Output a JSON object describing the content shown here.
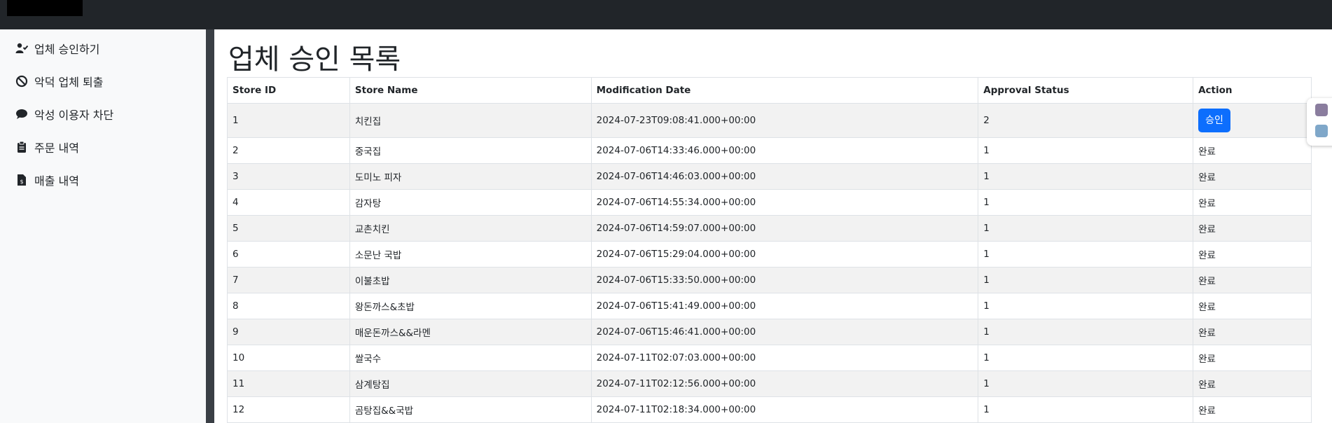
{
  "sidebar": {
    "items": [
      {
        "label": "업체 승인하기",
        "icon": "user-check-icon"
      },
      {
        "label": "악덕 업체 퇴출",
        "icon": "ban-icon"
      },
      {
        "label": "악성 이용자 차단",
        "icon": "comment-icon"
      },
      {
        "label": "주문 내역",
        "icon": "clipboard-icon"
      },
      {
        "label": "매출 내역",
        "icon": "file-invoice-dollar-icon"
      }
    ]
  },
  "main": {
    "title": "업체 승인 목록",
    "table": {
      "headers": [
        "Store ID",
        "Store Name",
        "Modification Date",
        "Approval Status",
        "Action"
      ],
      "rows": [
        {
          "id": "1",
          "name": "치킨집",
          "date": "2024-07-23T09:08:41.000+00:00",
          "status": "2",
          "action": "승인"
        },
        {
          "id": "2",
          "name": "중국집",
          "date": "2024-07-06T14:33:46.000+00:00",
          "status": "1",
          "action": "완료"
        },
        {
          "id": "3",
          "name": "도미노 피자",
          "date": "2024-07-06T14:46:03.000+00:00",
          "status": "1",
          "action": "완료"
        },
        {
          "id": "4",
          "name": "감자탕",
          "date": "2024-07-06T14:55:34.000+00:00",
          "status": "1",
          "action": "완료"
        },
        {
          "id": "5",
          "name": "교촌치킨",
          "date": "2024-07-06T14:59:07.000+00:00",
          "status": "1",
          "action": "완료"
        },
        {
          "id": "6",
          "name": "소문난 국밥",
          "date": "2024-07-06T15:29:04.000+00:00",
          "status": "1",
          "action": "완료"
        },
        {
          "id": "7",
          "name": "이불초밥",
          "date": "2024-07-06T15:33:50.000+00:00",
          "status": "1",
          "action": "완료"
        },
        {
          "id": "8",
          "name": "왕돈까스&초밥",
          "date": "2024-07-06T15:41:49.000+00:00",
          "status": "1",
          "action": "완료"
        },
        {
          "id": "9",
          "name": "매운돈까스&&라멘",
          "date": "2024-07-06T15:46:41.000+00:00",
          "status": "1",
          "action": "완료"
        },
        {
          "id": "10",
          "name": "쌀국수",
          "date": "2024-07-11T02:07:03.000+00:00",
          "status": "1",
          "action": "완료"
        },
        {
          "id": "11",
          "name": "삼계탕집",
          "date": "2024-07-11T02:12:56.000+00:00",
          "status": "1",
          "action": "완료"
        },
        {
          "id": "12",
          "name": "곰탕집&&국밥",
          "date": "2024-07-11T02:18:34.000+00:00",
          "status": "1",
          "action": "완료"
        }
      ]
    }
  },
  "colors": {
    "topbar": "#212529",
    "sidebar": "#f8f9fa",
    "accent": "#0d6efd",
    "stripe": "#f2f2f2"
  }
}
